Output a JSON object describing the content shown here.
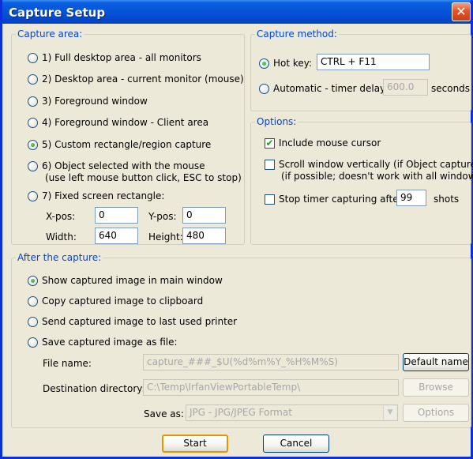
{
  "window": {
    "title": "Capture Setup",
    "close_glyph": "✕"
  },
  "capture_area": {
    "legend": "Capture area:",
    "options": [
      {
        "label": "1) Full desktop area - all monitors",
        "checked": false
      },
      {
        "label": "2) Desktop area - current monitor (mouse)",
        "checked": false
      },
      {
        "label": "3) Foreground window",
        "checked": false
      },
      {
        "label": "4) Foreground window - Client area",
        "checked": false
      },
      {
        "label": "5) Custom rectangle/region capture",
        "checked": true
      },
      {
        "label": "6) Object selected with the mouse",
        "sub": "(use left mouse button click, ESC to stop)",
        "checked": false
      },
      {
        "label": "7) Fixed screen rectangle:",
        "checked": false
      }
    ],
    "fixed": {
      "xpos_label": "X-pos:",
      "xpos_value": "0",
      "ypos_label": "Y-pos:",
      "ypos_value": "0",
      "width_label": "Width:",
      "width_value": "640",
      "height_label": "Height:",
      "height_value": "480"
    }
  },
  "capture_method": {
    "legend": "Capture method:",
    "hotkey_label": "Hot key:",
    "hotkey_value": "CTRL + F11",
    "hotkey_checked": true,
    "auto_label": "Automatic - timer delay:",
    "auto_value": "600.0",
    "auto_unit": "seconds",
    "auto_checked": false
  },
  "options": {
    "legend": "Options:",
    "include_cursor": {
      "label": "Include mouse cursor",
      "checked": true
    },
    "scroll_window": {
      "label": "Scroll window vertically (if Object capture)",
      "sub": "(if possible; doesn't work with all windows)",
      "checked": false
    },
    "stop_timer": {
      "label": "Stop timer capturing after:",
      "value": "99",
      "unit": "shots",
      "checked": false
    }
  },
  "after_capture": {
    "legend": "After the capture:",
    "options": [
      {
        "label": "Show captured image in main window",
        "checked": true
      },
      {
        "label": "Copy captured image to clipboard",
        "checked": false
      },
      {
        "label": "Send captured image to last used printer",
        "checked": false
      },
      {
        "label": "Save captured image as file:",
        "checked": false
      }
    ],
    "file_name_label": "File name:",
    "file_name_value": "capture_###_$U(%d%m%Y_%H%M%S)",
    "default_name_button": "Default name",
    "dest_dir_label": "Destination directory:",
    "dest_dir_value": "C:\\Temp\\IrfanViewPortableTemp\\",
    "browse_button": "Browse",
    "save_as_label": "Save as:",
    "save_as_value": "JPG - JPG/JPEG Format",
    "options_button": "Options"
  },
  "footer": {
    "start_button": "Start",
    "cancel_button": "Cancel"
  },
  "colors": {
    "title_bar": "#0a5fe0",
    "dialog_bg": "#ece9d8",
    "group_label": "#0046d5",
    "default_button_border": "#e59700",
    "close_button": "#e2552d"
  }
}
